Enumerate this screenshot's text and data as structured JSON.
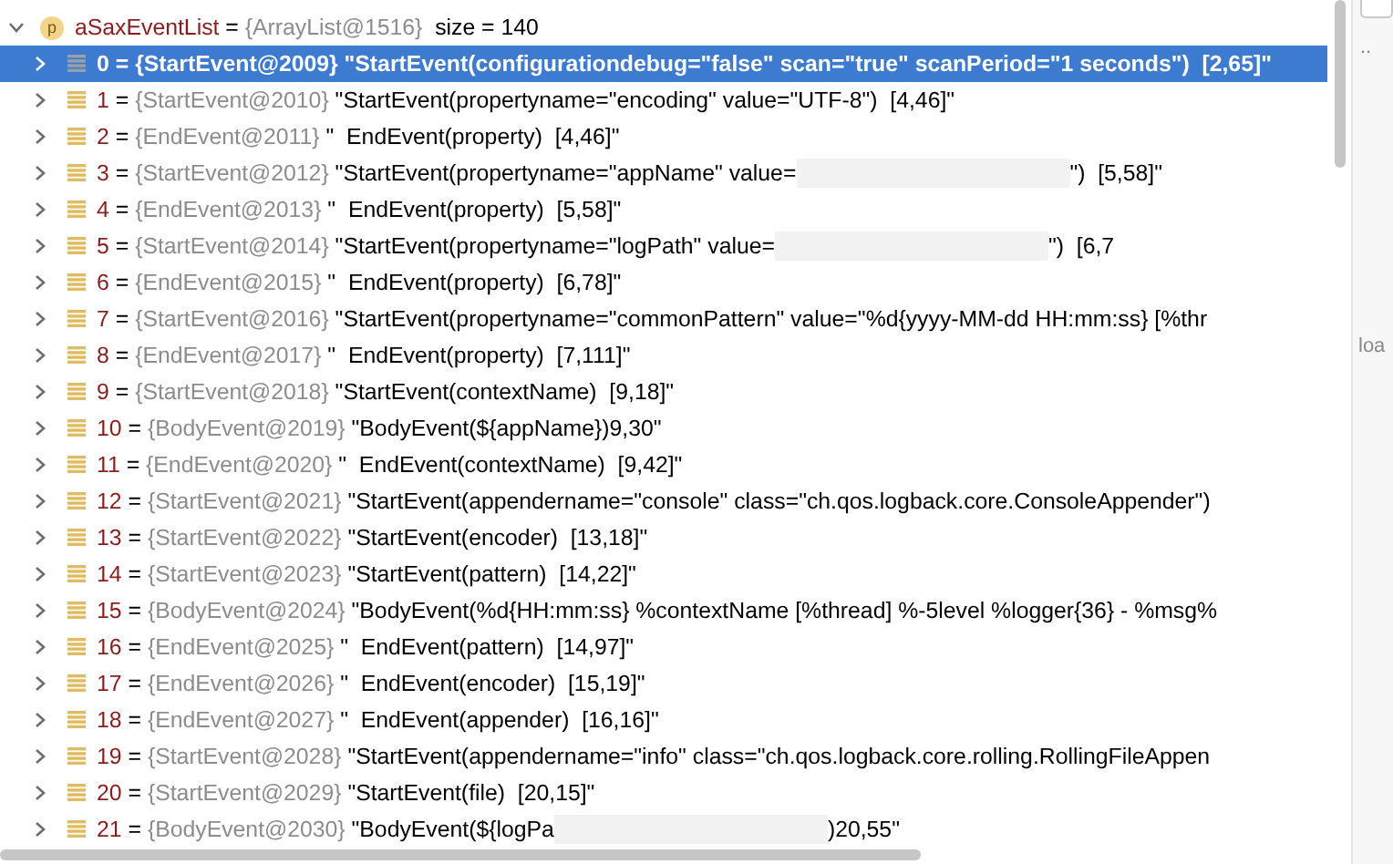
{
  "variable": {
    "expanded": true,
    "badge": "p",
    "name": "aSaxEventList",
    "eq": "=",
    "ref": "{ArrayList@1516}",
    "extra": "size = 140"
  },
  "rows": [
    {
      "index": "0",
      "eq": "=",
      "ref": "{StartEvent@2009}",
      "selected": true,
      "value": [
        {
          "kind": "text",
          "text": "\"StartEvent(configurationdebug=\"false\" scan=\"true\" scanPeriod=\"1 seconds\")  [2,65]\""
        }
      ]
    },
    {
      "index": "1",
      "eq": "=",
      "ref": "{StartEvent@2010}",
      "selected": false,
      "value": [
        {
          "kind": "text",
          "text": "\"StartEvent(propertyname=\"encoding\" value=\"UTF-8\")  [4,46]\""
        }
      ]
    },
    {
      "index": "2",
      "eq": "=",
      "ref": "{EndEvent@2011}",
      "selected": false,
      "value": [
        {
          "kind": "text",
          "text": "\"  EndEvent(property)  [4,46]\""
        }
      ]
    },
    {
      "index": "3",
      "eq": "=",
      "ref": "{StartEvent@2012}",
      "selected": false,
      "value": [
        {
          "kind": "text",
          "text": "\"StartEvent(propertyname=\"appName\" value="
        },
        {
          "kind": "redacted"
        },
        {
          "kind": "text",
          "text": "\")  [5,58]\""
        }
      ]
    },
    {
      "index": "4",
      "eq": "=",
      "ref": "{EndEvent@2013}",
      "selected": false,
      "value": [
        {
          "kind": "text",
          "text": "\"  EndEvent(property)  [5,58]\""
        }
      ]
    },
    {
      "index": "5",
      "eq": "=",
      "ref": "{StartEvent@2014}",
      "selected": false,
      "value": [
        {
          "kind": "text",
          "text": "\"StartEvent(propertyname=\"logPath\" value="
        },
        {
          "kind": "redacted"
        },
        {
          "kind": "text",
          "text": "\")  [6,7"
        }
      ]
    },
    {
      "index": "6",
      "eq": "=",
      "ref": "{EndEvent@2015}",
      "selected": false,
      "value": [
        {
          "kind": "text",
          "text": "\"  EndEvent(property)  [6,78]\""
        }
      ]
    },
    {
      "index": "7",
      "eq": "=",
      "ref": "{StartEvent@2016}",
      "selected": false,
      "value": [
        {
          "kind": "text",
          "text": "\"StartEvent(propertyname=\"commonPattern\" value=\"%d{yyyy-MM-dd HH:mm:ss} [%thr"
        }
      ]
    },
    {
      "index": "8",
      "eq": "=",
      "ref": "{EndEvent@2017}",
      "selected": false,
      "value": [
        {
          "kind": "text",
          "text": "\"  EndEvent(property)  [7,111]\""
        }
      ]
    },
    {
      "index": "9",
      "eq": "=",
      "ref": "{StartEvent@2018}",
      "selected": false,
      "value": [
        {
          "kind": "text",
          "text": "\"StartEvent(contextName)  [9,18]\""
        }
      ]
    },
    {
      "index": "10",
      "eq": "=",
      "ref": "{BodyEvent@2019}",
      "selected": false,
      "value": [
        {
          "kind": "text",
          "text": "\"BodyEvent(${appName})9,30\""
        }
      ]
    },
    {
      "index": "11",
      "eq": "=",
      "ref": "{EndEvent@2020}",
      "selected": false,
      "value": [
        {
          "kind": "text",
          "text": "\"  EndEvent(contextName)  [9,42]\""
        }
      ]
    },
    {
      "index": "12",
      "eq": "=",
      "ref": "{StartEvent@2021}",
      "selected": false,
      "value": [
        {
          "kind": "text",
          "text": "\"StartEvent(appendername=\"console\" class=\"ch.qos.logback.core.ConsoleAppender\")"
        }
      ]
    },
    {
      "index": "13",
      "eq": "=",
      "ref": "{StartEvent@2022}",
      "selected": false,
      "value": [
        {
          "kind": "text",
          "text": "\"StartEvent(encoder)  [13,18]\""
        }
      ]
    },
    {
      "index": "14",
      "eq": "=",
      "ref": "{StartEvent@2023}",
      "selected": false,
      "value": [
        {
          "kind": "text",
          "text": "\"StartEvent(pattern)  [14,22]\""
        }
      ]
    },
    {
      "index": "15",
      "eq": "=",
      "ref": "{BodyEvent@2024}",
      "selected": false,
      "value": [
        {
          "kind": "text",
          "text": "\"BodyEvent(%d{HH:mm:ss} %contextName [%thread] %-5level %logger{36} - %msg%"
        }
      ]
    },
    {
      "index": "16",
      "eq": "=",
      "ref": "{EndEvent@2025}",
      "selected": false,
      "value": [
        {
          "kind": "text",
          "text": "\"  EndEvent(pattern)  [14,97]\""
        }
      ]
    },
    {
      "index": "17",
      "eq": "=",
      "ref": "{EndEvent@2026}",
      "selected": false,
      "value": [
        {
          "kind": "text",
          "text": "\"  EndEvent(encoder)  [15,19]\""
        }
      ]
    },
    {
      "index": "18",
      "eq": "=",
      "ref": "{EndEvent@2027}",
      "selected": false,
      "value": [
        {
          "kind": "text",
          "text": "\"  EndEvent(appender)  [16,16]\""
        }
      ]
    },
    {
      "index": "19",
      "eq": "=",
      "ref": "{StartEvent@2028}",
      "selected": false,
      "value": [
        {
          "kind": "text",
          "text": "\"StartEvent(appendername=\"info\" class=\"ch.qos.logback.core.rolling.RollingFileAppen"
        }
      ]
    },
    {
      "index": "20",
      "eq": "=",
      "ref": "{StartEvent@2029}",
      "selected": false,
      "value": [
        {
          "kind": "text",
          "text": "\"StartEvent(file)  [20,15]\""
        }
      ]
    },
    {
      "index": "21",
      "eq": "=",
      "ref": "{BodyEvent@2030}",
      "selected": false,
      "value": [
        {
          "kind": "text",
          "text": "\"BodyEvent(${logPa"
        },
        {
          "kind": "redacted"
        },
        {
          "kind": "text",
          "text": ")20,55\""
        }
      ]
    }
  ],
  "side_panel": {
    "breadcrumb": "..",
    "hint": "loa"
  }
}
